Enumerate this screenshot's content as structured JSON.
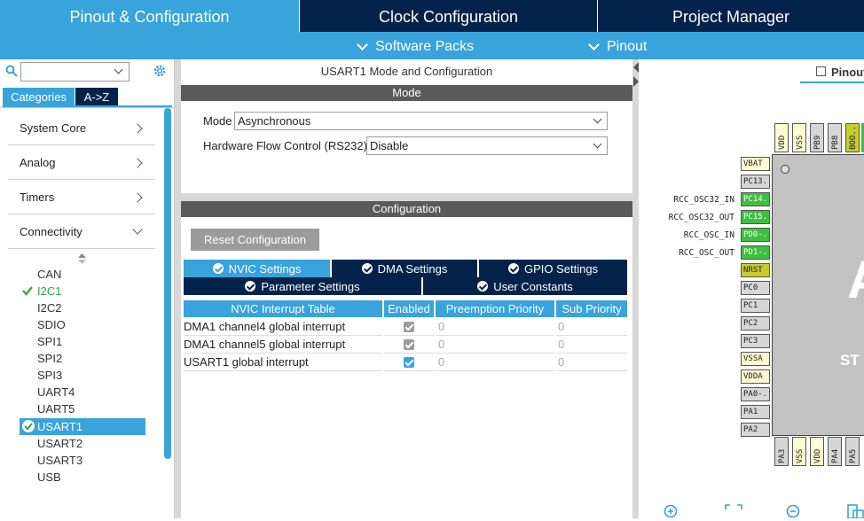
{
  "top_tabs": [
    "Pinout & Configuration",
    "Clock Configuration",
    "Project Manager"
  ],
  "sub_menu": [
    "Software Packs",
    "Pinout"
  ],
  "left": {
    "tabs": [
      "Categories",
      "A->Z"
    ],
    "categories": [
      "System Core",
      "Analog",
      "Timers",
      "Connectivity"
    ],
    "peripherals": [
      "CAN",
      "I2C1",
      "I2C2",
      "SDIO",
      "SPI1",
      "SPI2",
      "SPI3",
      "UART4",
      "UART5",
      "USART1",
      "USART2",
      "USART3",
      "USB"
    ]
  },
  "middle": {
    "title": "USART1 Mode and Configuration",
    "mode_header": "Mode",
    "mode_label": "Mode",
    "mode_value": "Asynchronous",
    "flow_label": "Hardware Flow Control (RS232)",
    "flow_value": "Disable",
    "config_header": "Configuration",
    "reset_button": "Reset Configuration",
    "tabs_row1": [
      "NVIC Settings",
      "DMA Settings",
      "GPIO Settings"
    ],
    "tabs_row2": [
      "Parameter Settings",
      "User Constants"
    ],
    "table": {
      "headers": [
        "NVIC Interrupt Table",
        "Enabled",
        "Preemption Priority",
        "Sub Priority"
      ],
      "rows": [
        {
          "name": "DMA1 channel4 global interrupt",
          "enabled": true,
          "locked": true,
          "preemption": "0",
          "sub": "0"
        },
        {
          "name": "DMA1 channel5 global interrupt",
          "enabled": true,
          "locked": true,
          "preemption": "0",
          "sub": "0"
        },
        {
          "name": "USART1 global interrupt",
          "enabled": true,
          "locked": false,
          "preemption": "0",
          "sub": "0"
        }
      ]
    }
  },
  "right": {
    "view_label": "Pinout",
    "chip_text": "ST",
    "chip_text2": "A",
    "top_pins": [
      "VDD",
      "VSS",
      "PB9",
      "PB8",
      "BOO.."
    ],
    "left_pins": [
      "VBAT",
      "PC13..",
      "PC14..",
      "PC15..",
      "PD0-..",
      "PD1-..",
      "NRST",
      "PC0",
      "PC1",
      "PC2",
      "PC3",
      "VSSA",
      "VDDA",
      "PA0-..",
      "PA1",
      "PA2"
    ],
    "signals": [
      "RCC_OSC32_IN",
      "RCC_OSC32_OUT",
      "RCC_OSC_IN",
      "RCC_OSC_OUT"
    ],
    "bottom_pins": [
      "PA3",
      "VSS",
      "VDD",
      "PA4",
      "PA5"
    ]
  },
  "colors": {
    "dark_navy": "#03234b",
    "accent_blue": "#39a3dc",
    "pin_green": "#3fbf3f",
    "pin_yellow": "#fffbd0",
    "pin_gray": "#d6d6d6",
    "pin_olive": "#c6cc2a"
  }
}
